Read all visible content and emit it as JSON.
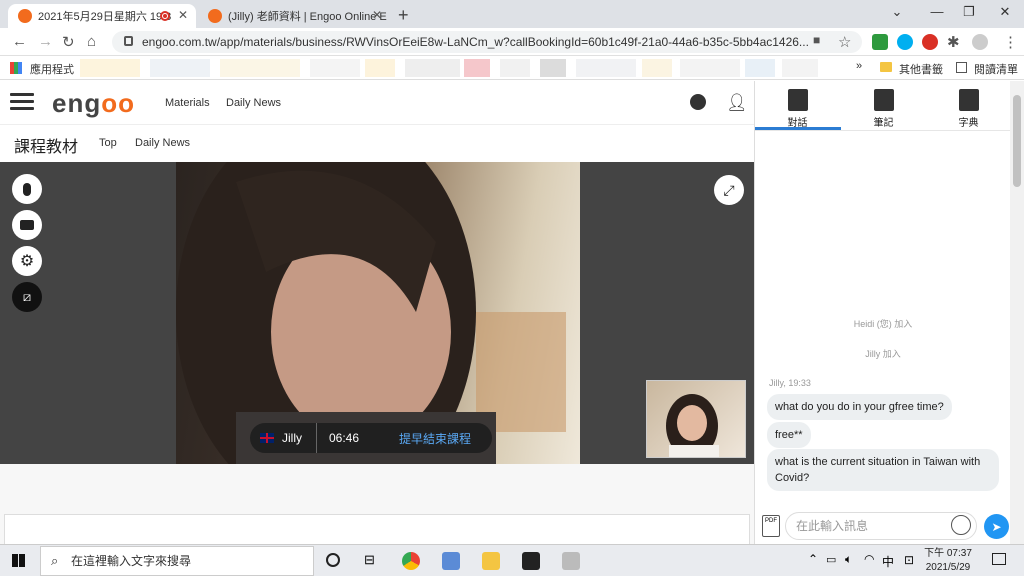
{
  "browser": {
    "tabs": [
      {
        "label": "2021年5月29日星期六 19:3",
        "active": true
      },
      {
        "label": "(Jilly) 老師資料 | Engoo Online E",
        "active": false
      }
    ],
    "url": "engoo.com.tw/app/materials/business/RWVinsOrEeiE8w-LaNCm_w?callBookingId=60b1c49f-21a0-44a6-b35c-5bb4ac1426...",
    "ext_badge": "11",
    "bookmarks": {
      "apps": "應用程式",
      "other": "其他書籤",
      "reading": "閱讀清單"
    }
  },
  "header": {
    "logo": {
      "prefix": "eng",
      "suffix": "oo"
    },
    "links": [
      "Materials",
      "Daily News"
    ]
  },
  "subheader": {
    "title": "課程教材",
    "links": [
      "Top",
      "Daily News"
    ]
  },
  "call": {
    "teacher_name": "Jilly",
    "timer": "06:46",
    "end_early": "提早結束課程"
  },
  "chat": {
    "tabs": [
      "對話",
      "筆記",
      "字典"
    ],
    "system_messages": [
      "Heidi (您) 加入",
      "Jilly 加入"
    ],
    "sender_line": "Jilly, 19:33",
    "messages": [
      "what do you do in your gfree time?",
      "free**",
      "what is the current situation in Taiwan with Covid?"
    ],
    "input_placeholder": "在此輸入訊息"
  },
  "taskbar": {
    "search_placeholder": "在這裡輸入文字來搜尋",
    "time": "下午 07:37",
    "date": "2021/5/29",
    "ime": "中"
  },
  "colors": {
    "brand": "#f26b1d",
    "accent": "#2b7cd3",
    "send": "#2196f3"
  }
}
